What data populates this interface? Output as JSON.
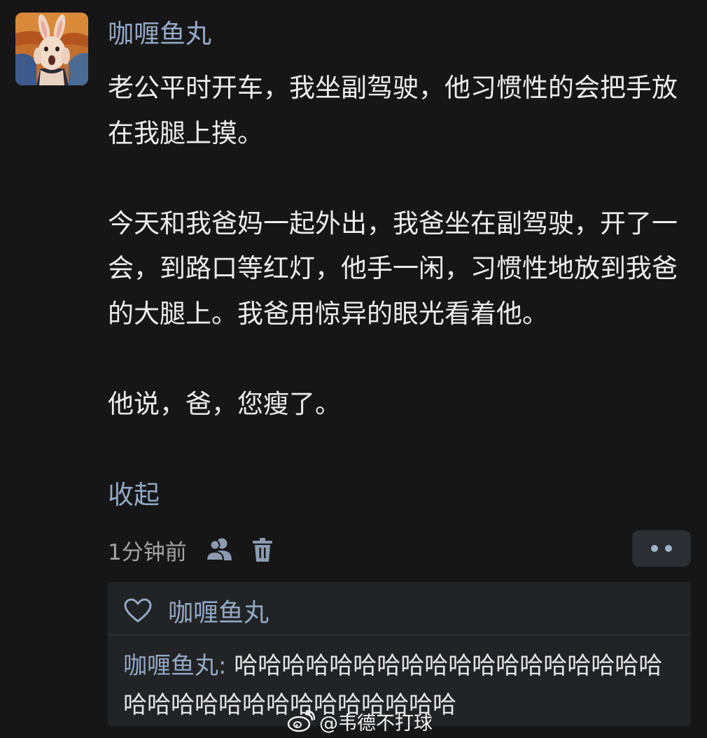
{
  "comment": {
    "avatar_icon": "screaming-rabbit-painting-avatar",
    "username": "咖喱鱼丸",
    "paragraphs": [
      "老公平时开车，我坐副驾驶，他习惯性的会把手放在我腿上摸。",
      "今天和我爸妈一起外出，我爸坐在副驾驶，开了一会，到路口等红灯，他手一闲，习惯性地放到我爸的大腿上。我爸用惊异的眼光看着他。",
      "他说，爸，您瘦了。"
    ],
    "collapse_label": "收起",
    "timestamp": "1分钟前",
    "icons": {
      "visibility": "people-icon",
      "delete": "trash-icon",
      "more": "more-dots-icon"
    }
  },
  "reply_section": {
    "like_icon": "heart-outline-icon",
    "liker_name": "咖喱鱼丸",
    "reply": {
      "author": "咖喱鱼丸",
      "separator": ": ",
      "text": "哈哈哈哈哈哈哈哈哈哈哈哈哈哈哈哈哈哈哈哈哈哈哈哈哈哈哈哈哈哈哈哈"
    }
  },
  "watermark": {
    "icon": "weibo-logo-icon",
    "text": "@韦德不打球"
  },
  "colors": {
    "background": "#161616",
    "link_blue": "#93a8c4",
    "body_text": "#ececec",
    "reply_panel": "#222325"
  }
}
